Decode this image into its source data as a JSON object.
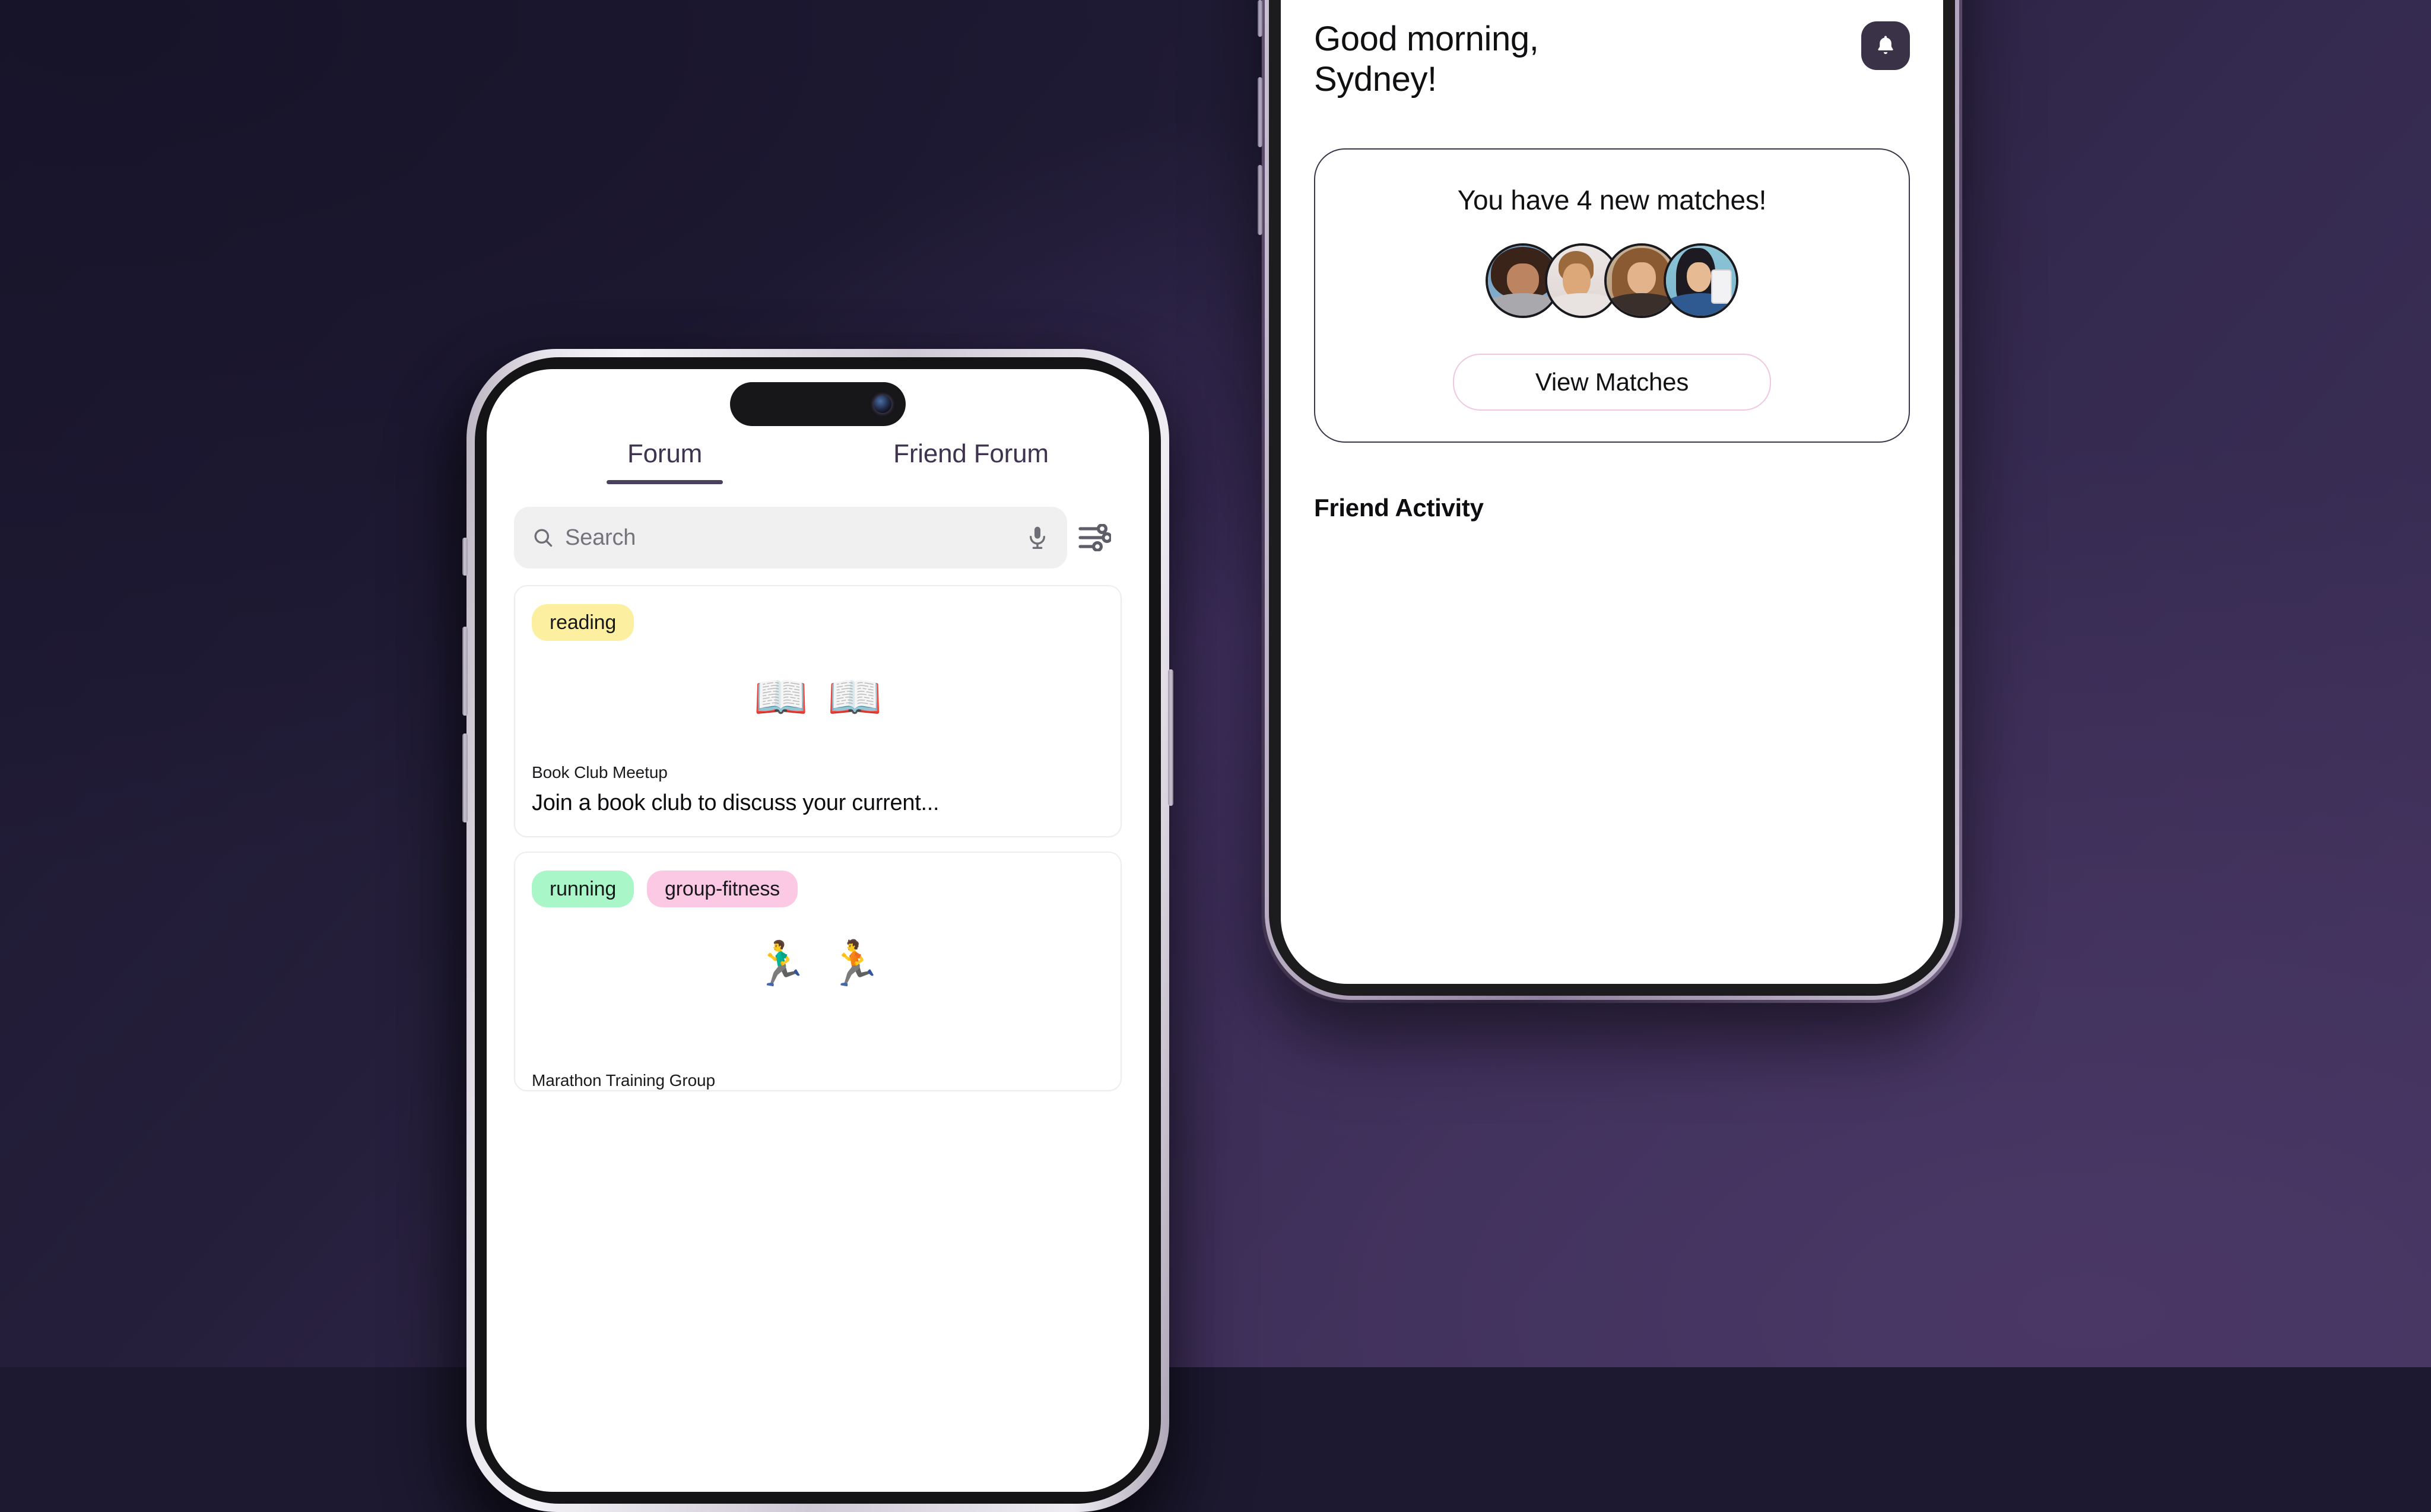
{
  "background": {
    "from": "#1c1730",
    "to": "#3e3058"
  },
  "right_phone": {
    "greeting": "Good morning,\nSydney!",
    "bell_icon": "bell-icon",
    "matches_card": {
      "title": "You have 4 new matches!",
      "avatar_count": 4,
      "button_label": "View Matches",
      "button_border_color": "#efc7de"
    },
    "section_label": "Friend Activity"
  },
  "left_phone": {
    "tabs": [
      {
        "label": "Forum",
        "active": true
      },
      {
        "label": "Friend Forum",
        "active": false
      }
    ],
    "search": {
      "placeholder": "Search",
      "search_icon": "search-icon",
      "mic_icon": "microphone-icon",
      "filter_icon": "sliders-filter-icon"
    },
    "posts": [
      {
        "tags": [
          {
            "label": "reading",
            "color": "#fcf0a0"
          }
        ],
        "emojis": [
          "📖",
          "📖"
        ],
        "subtitle": "Book Club Meetup",
        "title": "Join a book club to discuss your current..."
      },
      {
        "tags": [
          {
            "label": "running",
            "color": "#a9f7c9"
          },
          {
            "label": "group-fitness",
            "color": "#fcc9e4"
          }
        ],
        "emojis": [
          "🏃‍♂️",
          "🏃"
        ],
        "subtitle": "Marathon Training Group",
        "title": ""
      }
    ]
  }
}
